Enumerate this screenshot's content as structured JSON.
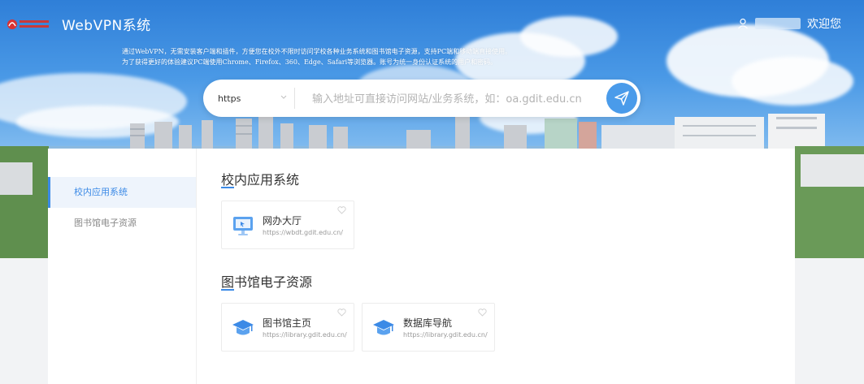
{
  "header": {
    "app_title": "WebVPN系统",
    "welcome": "欢迎您"
  },
  "notice": "通过WebVPN，无需安装客户端和插件，方便您在校外不限时访问学校各种业务系统和图书馆电子资源，支持PC端和移动端直接使用。为了获得更好的体验建议PC端使用Chrome、Firefox、360、Edge、Safari等浏览器。账号为统一身份认证系统的用户和密码。",
  "search": {
    "protocol": "https",
    "placeholder": "输入地址可直接访问网站/业务系统，如：oa.gdit.edu.cn"
  },
  "sidebar": {
    "items": [
      {
        "label": "校内应用系统",
        "active": true
      },
      {
        "label": "图书馆电子资源",
        "active": false
      }
    ]
  },
  "sections": [
    {
      "title": "校内应用系统",
      "apps": [
        {
          "name": "网办大厅",
          "url": "https://wbdt.gdit.edu.cn/",
          "icon": "monitor-icon"
        }
      ]
    },
    {
      "title": "图书馆电子资源",
      "apps": [
        {
          "name": "图书馆主页",
          "url": "https://library.gdit.edu.cn/",
          "icon": "graduation-cap-icon"
        },
        {
          "name": "数据库导航",
          "url": "https://library.gdit.edu.cn/",
          "icon": "graduation-cap-icon"
        }
      ]
    }
  ],
  "colors": {
    "accent": "#3c8ae6",
    "sky_top": "#2f7fd8",
    "go_button": "#4a9bea"
  }
}
